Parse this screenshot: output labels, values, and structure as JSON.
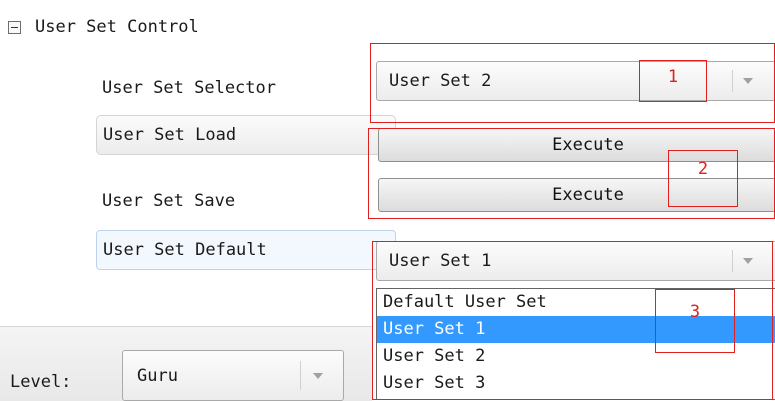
{
  "group": {
    "title": "User Set Control"
  },
  "rows": {
    "selector": {
      "label": "User Set Selector",
      "value": "User Set 2"
    },
    "load": {
      "label": "User Set Load",
      "button": "Execute"
    },
    "save": {
      "label": "User Set Save",
      "button": "Execute"
    },
    "default": {
      "label": "User Set Default",
      "value": "User Set 1"
    }
  },
  "dropdown": {
    "options": [
      "Default User Set",
      "User Set 1",
      "User Set 2",
      "User Set 3"
    ],
    "selected": "User Set 1"
  },
  "annotations": [
    "1",
    "2",
    "3"
  ],
  "level": {
    "label": "Level:",
    "value": "Guru"
  },
  "colors": {
    "annotation_red": "#e02020",
    "selection_blue": "#3399ff"
  },
  "icons": {
    "collapse": "minus-box-icon",
    "dropdown": "chevron-down-icon"
  }
}
